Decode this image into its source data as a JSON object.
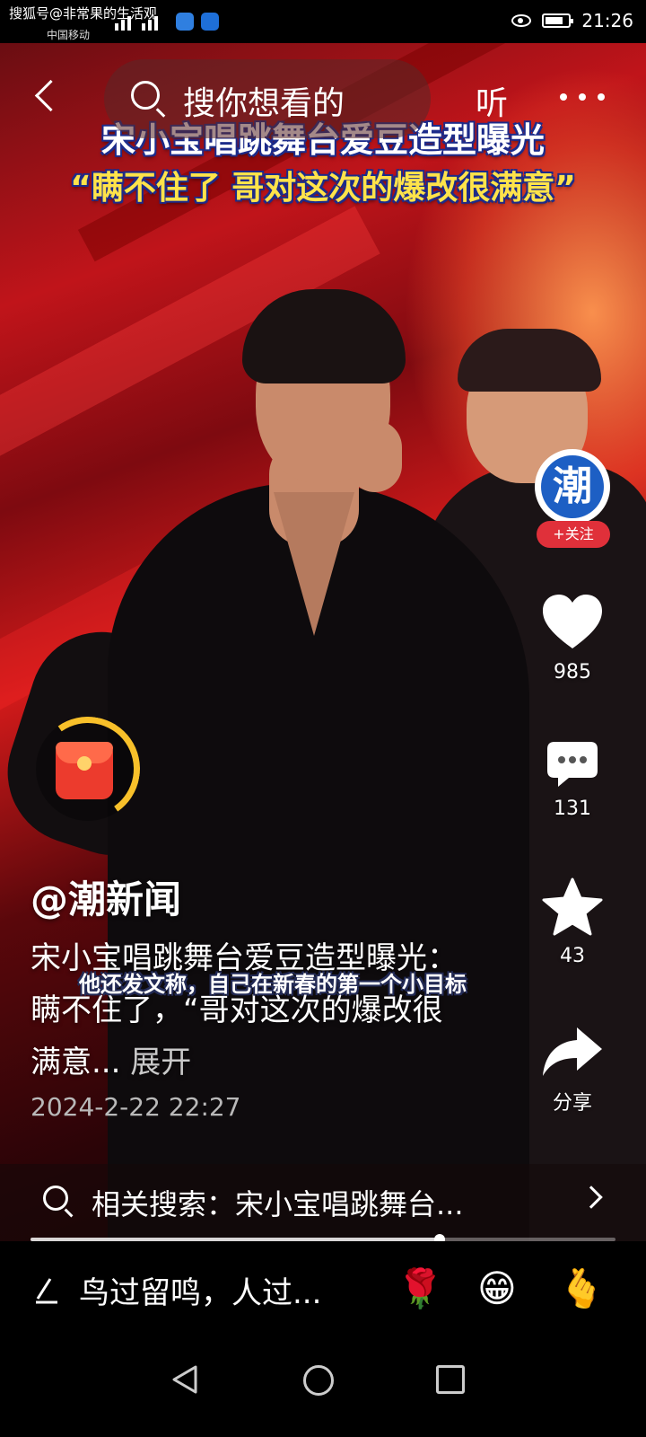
{
  "status_bar": {
    "carrier_overlay": "搜狐号@非常果的生活观",
    "carrier": "中国移动",
    "time": "21:26"
  },
  "top_bar": {
    "search_placeholder": "搜你想看的",
    "listen_label": "听"
  },
  "video": {
    "headline_line1": "宋小宝唱跳舞台爱豆造型曝光",
    "headline_line2": "“瞒不住了 哥对这次的爆改很满意”",
    "subtitle_caption": "他还发文称，自己在新春的第一个小目标"
  },
  "author": {
    "handle": "@潮新闻",
    "avatar_glyph": "潮",
    "follow_label": "+关注"
  },
  "actions": {
    "likes": "985",
    "comments": "131",
    "favorites": "43",
    "share_label": "分享"
  },
  "post": {
    "description": "宋小宝唱跳舞台爱豆造型曝光：瞒不住了，“哥对这次的爆改很满意...",
    "expand_label": "展开",
    "timestamp": "2024-2-22 22:27"
  },
  "related_search": {
    "text": "相关搜索：宋小宝唱跳舞台..."
  },
  "playback": {
    "progress_percent": 70
  },
  "comment_bar": {
    "placeholder": "鸟过留鸣，人过...",
    "emojis": [
      "🌹",
      "😁",
      "🫰"
    ]
  },
  "icons": {
    "back": "back-chevron-icon",
    "search": "search-icon",
    "more": "more-dots-icon",
    "like": "heart-icon",
    "comment": "comment-bubble-icon",
    "favorite": "star-icon",
    "share": "share-arrow-icon",
    "red_packet": "red-packet-icon",
    "compose": "pen-icon"
  },
  "colors": {
    "follow_button": "#e0303a",
    "headline_line2": "#ffe34a",
    "red_packet_ring": "#f8c02a"
  }
}
